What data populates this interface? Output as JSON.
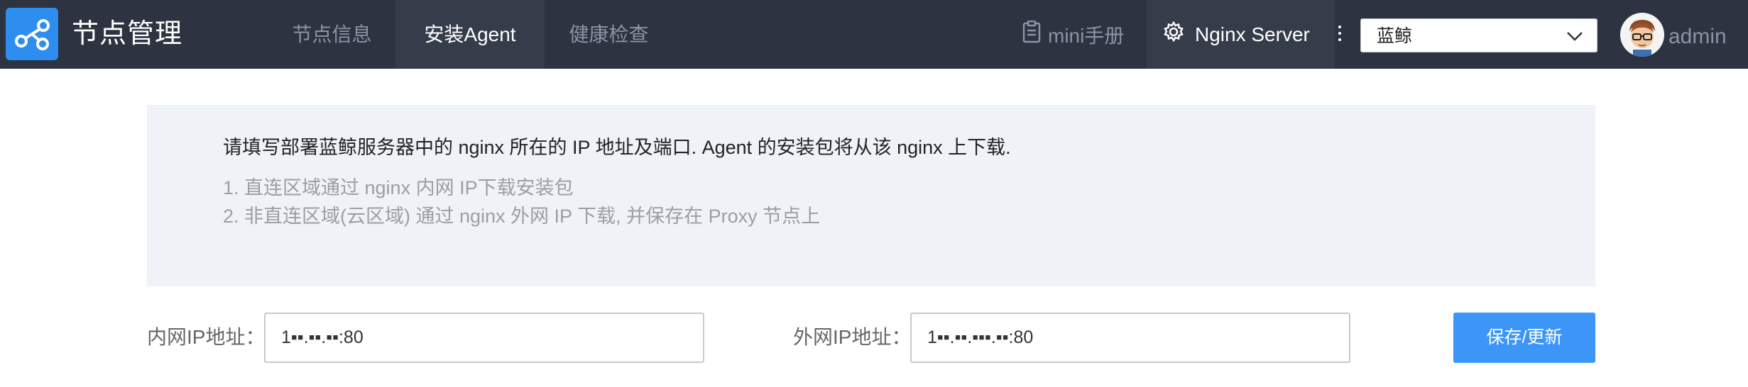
{
  "header": {
    "app_title": "节点管理",
    "logo_icon": "node-graph-icon",
    "tabs": [
      {
        "label": "节点信息",
        "active": false
      },
      {
        "label": "安装Agent",
        "active": true
      },
      {
        "label": "健康检查",
        "active": false
      }
    ],
    "doc_link_label": "mini手册",
    "doc_icon": "clipboard-icon",
    "server_label": "Nginx Server",
    "server_icon": "gear-icon",
    "more_icon": "vertical-dots-icon",
    "business_select": {
      "value": "蓝鲸",
      "icon": "chevron-down-icon"
    },
    "user": {
      "name": "admin",
      "avatar_icon": "avatar-icon"
    }
  },
  "info": {
    "main": "请填写部署蓝鲸服务器中的 nginx 所在的 IP 地址及端口. Agent 的安装包将从该 nginx 上下载.",
    "notes": [
      "1. 直连区域通过 nginx 内网 IP下载安装包",
      "2. 非直连区域(云区域) 通过 nginx 外网 IP 下载, 并保存在 Proxy 节点上"
    ]
  },
  "form": {
    "inner_label": "内网IP地址：",
    "inner_value": "1▪▪.▪▪.▪▪:80",
    "outer_label": "外网IP地址：",
    "outer_value": "1▪▪.▪▪.▪▪▪.▪▪:80",
    "save_label": "保存/更新"
  },
  "colors": {
    "topbar": "#2d3340",
    "tab_active_bg": "#353c4a",
    "accent": "#3c96f7",
    "logo_bg": "#2e8ef0",
    "panel_bg": "#eff2f6"
  }
}
